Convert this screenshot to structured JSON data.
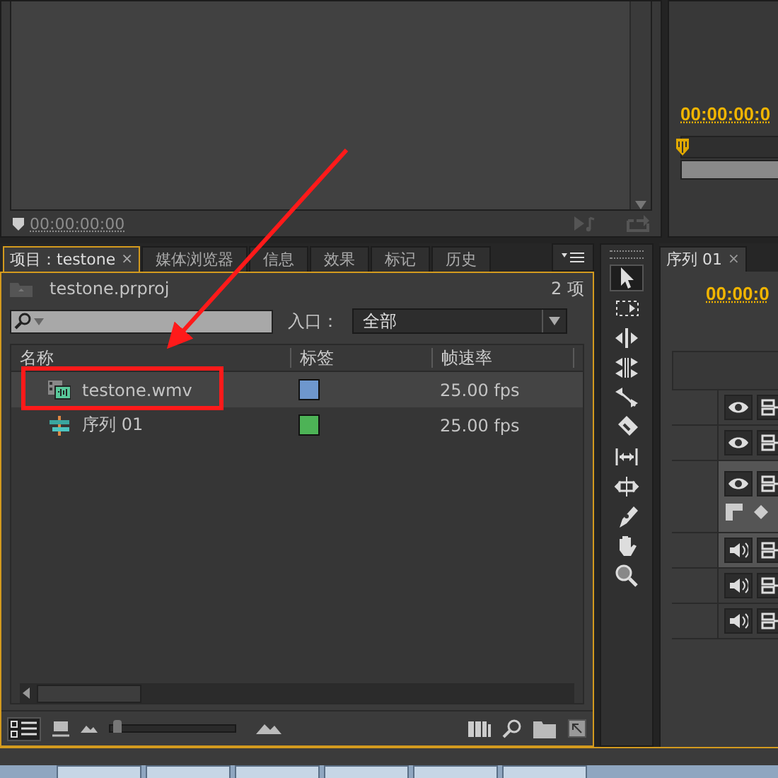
{
  "source_monitor": {
    "timecode": "00:00:00:00"
  },
  "program_monitor": {
    "timecode": "00:00:00:0"
  },
  "project_panel": {
    "tabs": [
      {
        "label": "项目：testone",
        "selected": true,
        "close": "×"
      },
      {
        "label": "媒体浏览器",
        "selected": false
      },
      {
        "label": "信息",
        "selected": false
      },
      {
        "label": "效果",
        "selected": false
      },
      {
        "label": "标记",
        "selected": false
      },
      {
        "label": "历史",
        "selected": false
      }
    ],
    "project_file": "testone.prproj",
    "item_count": "2 项",
    "filter_label": "入口：",
    "filter_value": "全部",
    "columns": [
      "名称",
      "标签",
      "帧速率"
    ],
    "rows": [
      {
        "name": "testone.wmv",
        "kind": "clip",
        "color": "#6e97cd",
        "frame_rate": "25.00 fps",
        "selected": true
      },
      {
        "name": "序列 01",
        "kind": "sequence",
        "color": "#4db356",
        "frame_rate": "25.00 fps",
        "selected": false
      }
    ],
    "zoom_slider": {
      "level": 0.02
    }
  },
  "tools": [
    {
      "selected": true
    },
    {
      "selected": false
    },
    {
      "selected": false
    },
    {
      "selected": false
    },
    {
      "selected": false
    },
    {
      "selected": false
    },
    {
      "selected": false
    },
    {
      "selected": false
    },
    {
      "selected": false
    },
    {
      "selected": false
    },
    {
      "selected": false
    }
  ],
  "timeline": {
    "tab": "序列 01",
    "close": "×",
    "timecode": "00:00:0",
    "tracks": [
      {
        "kind": "video",
        "selected": false
      },
      {
        "kind": "video",
        "selected": false
      },
      {
        "kind": "video",
        "selected": true
      },
      {
        "kind": "audio",
        "selected": true
      },
      {
        "kind": "audio",
        "selected": false
      },
      {
        "kind": "audio",
        "selected": false
      }
    ]
  },
  "annotations": {
    "arrow": true,
    "highlight_box": true
  }
}
